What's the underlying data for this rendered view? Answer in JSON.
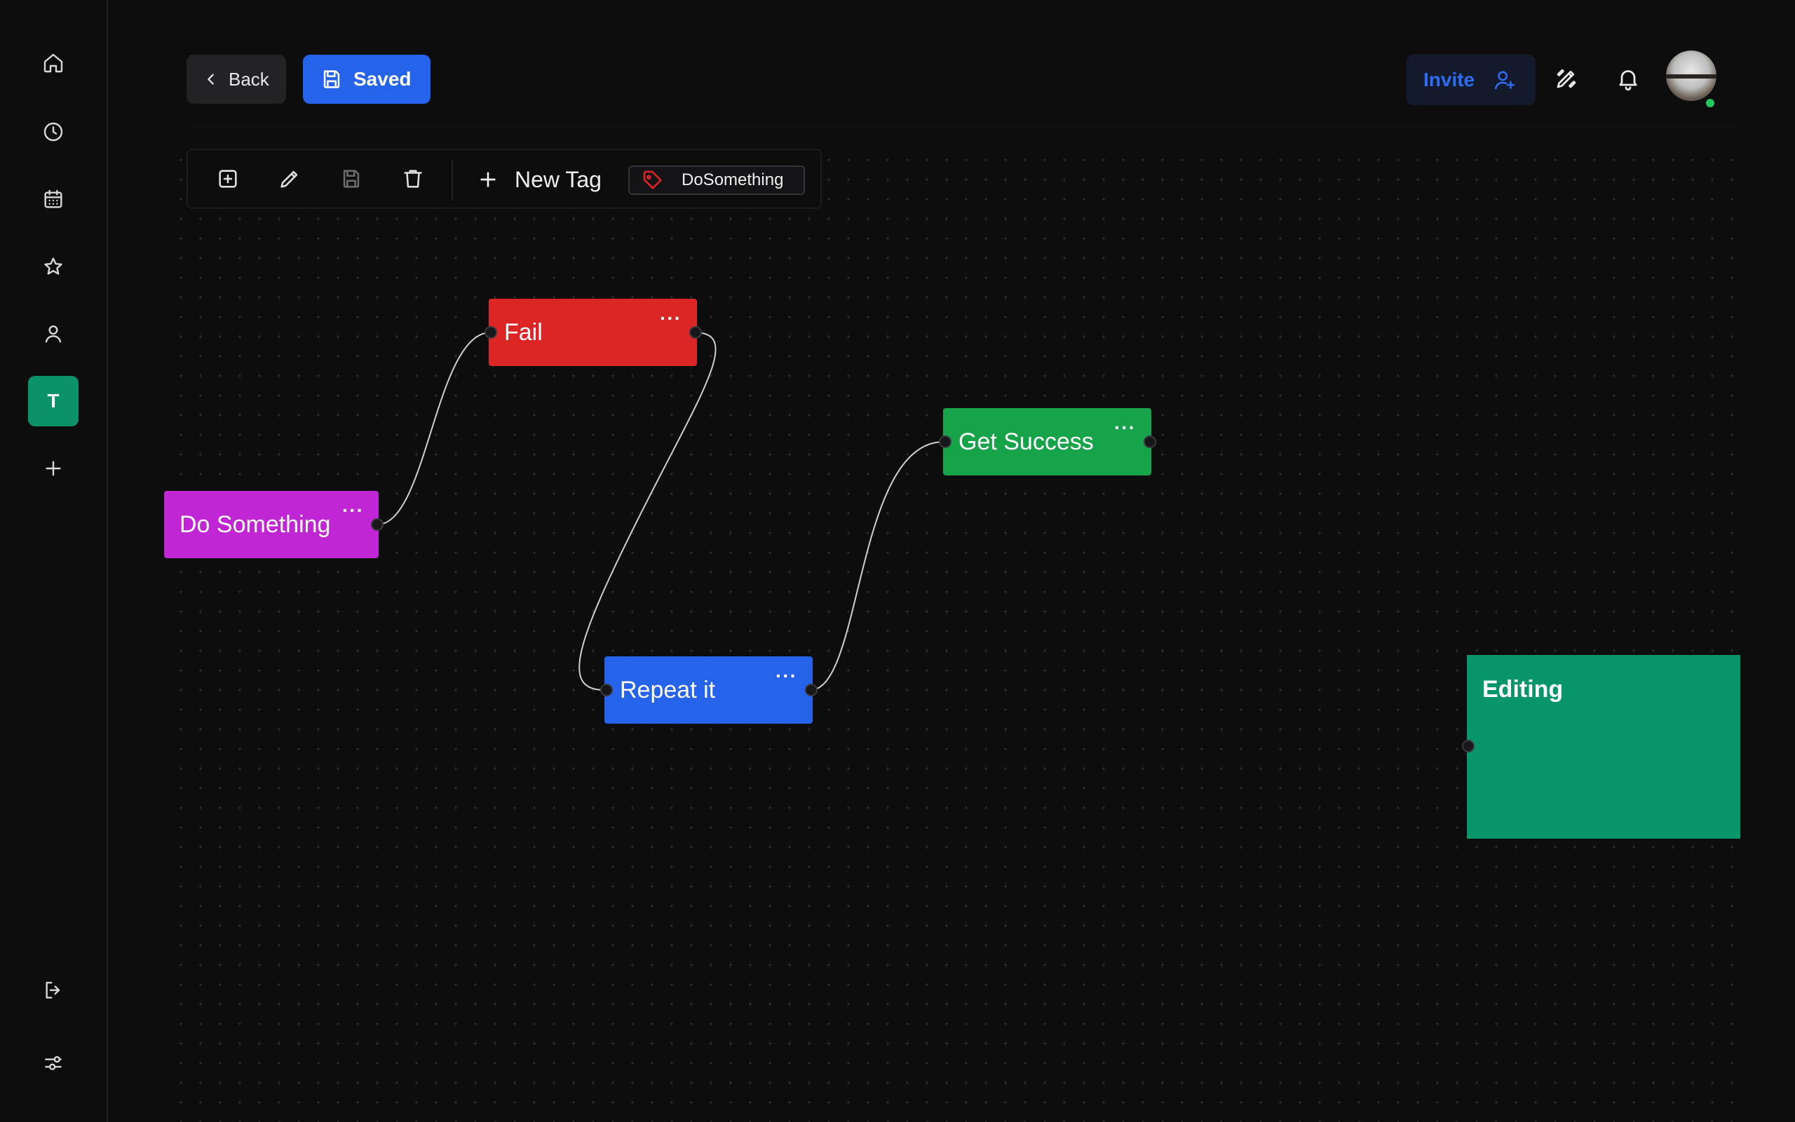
{
  "header": {
    "back_label": "Back",
    "saved_label": "Saved",
    "invite_label": "Invite"
  },
  "sidebar": {
    "items": [
      {
        "name": "home-icon"
      },
      {
        "name": "clock-icon"
      },
      {
        "name": "calendar-icon"
      },
      {
        "name": "star-icon"
      },
      {
        "name": "user-icon"
      },
      {
        "name": "workspace",
        "label": "T"
      },
      {
        "name": "plus-icon"
      }
    ],
    "bottom": [
      {
        "name": "logout-icon"
      },
      {
        "name": "settings-sliders-icon"
      }
    ]
  },
  "toolbar": {
    "new_tag_label": "New Tag",
    "tag_chip_label": "DoSomething",
    "tools": [
      "add-square-icon",
      "pencil-icon",
      "save-icon",
      "trash-icon"
    ]
  },
  "nodes": [
    {
      "id": "do-something",
      "label": "Do Something",
      "color": "#c026d3"
    },
    {
      "id": "fail",
      "label": "Fail",
      "color": "#dc2626"
    },
    {
      "id": "get-success",
      "label": "Get Success",
      "color": "#16a34a"
    },
    {
      "id": "repeat-it",
      "label": "Repeat it",
      "color": "#2563eb"
    }
  ],
  "editing_card": {
    "label": "Editing",
    "color": "#059669"
  },
  "node_menu_glyph": "···",
  "colors": {
    "accent": "#2563eb",
    "workspace": "#059669",
    "presence": "#22c55e",
    "tag_icon": "#e02424"
  }
}
